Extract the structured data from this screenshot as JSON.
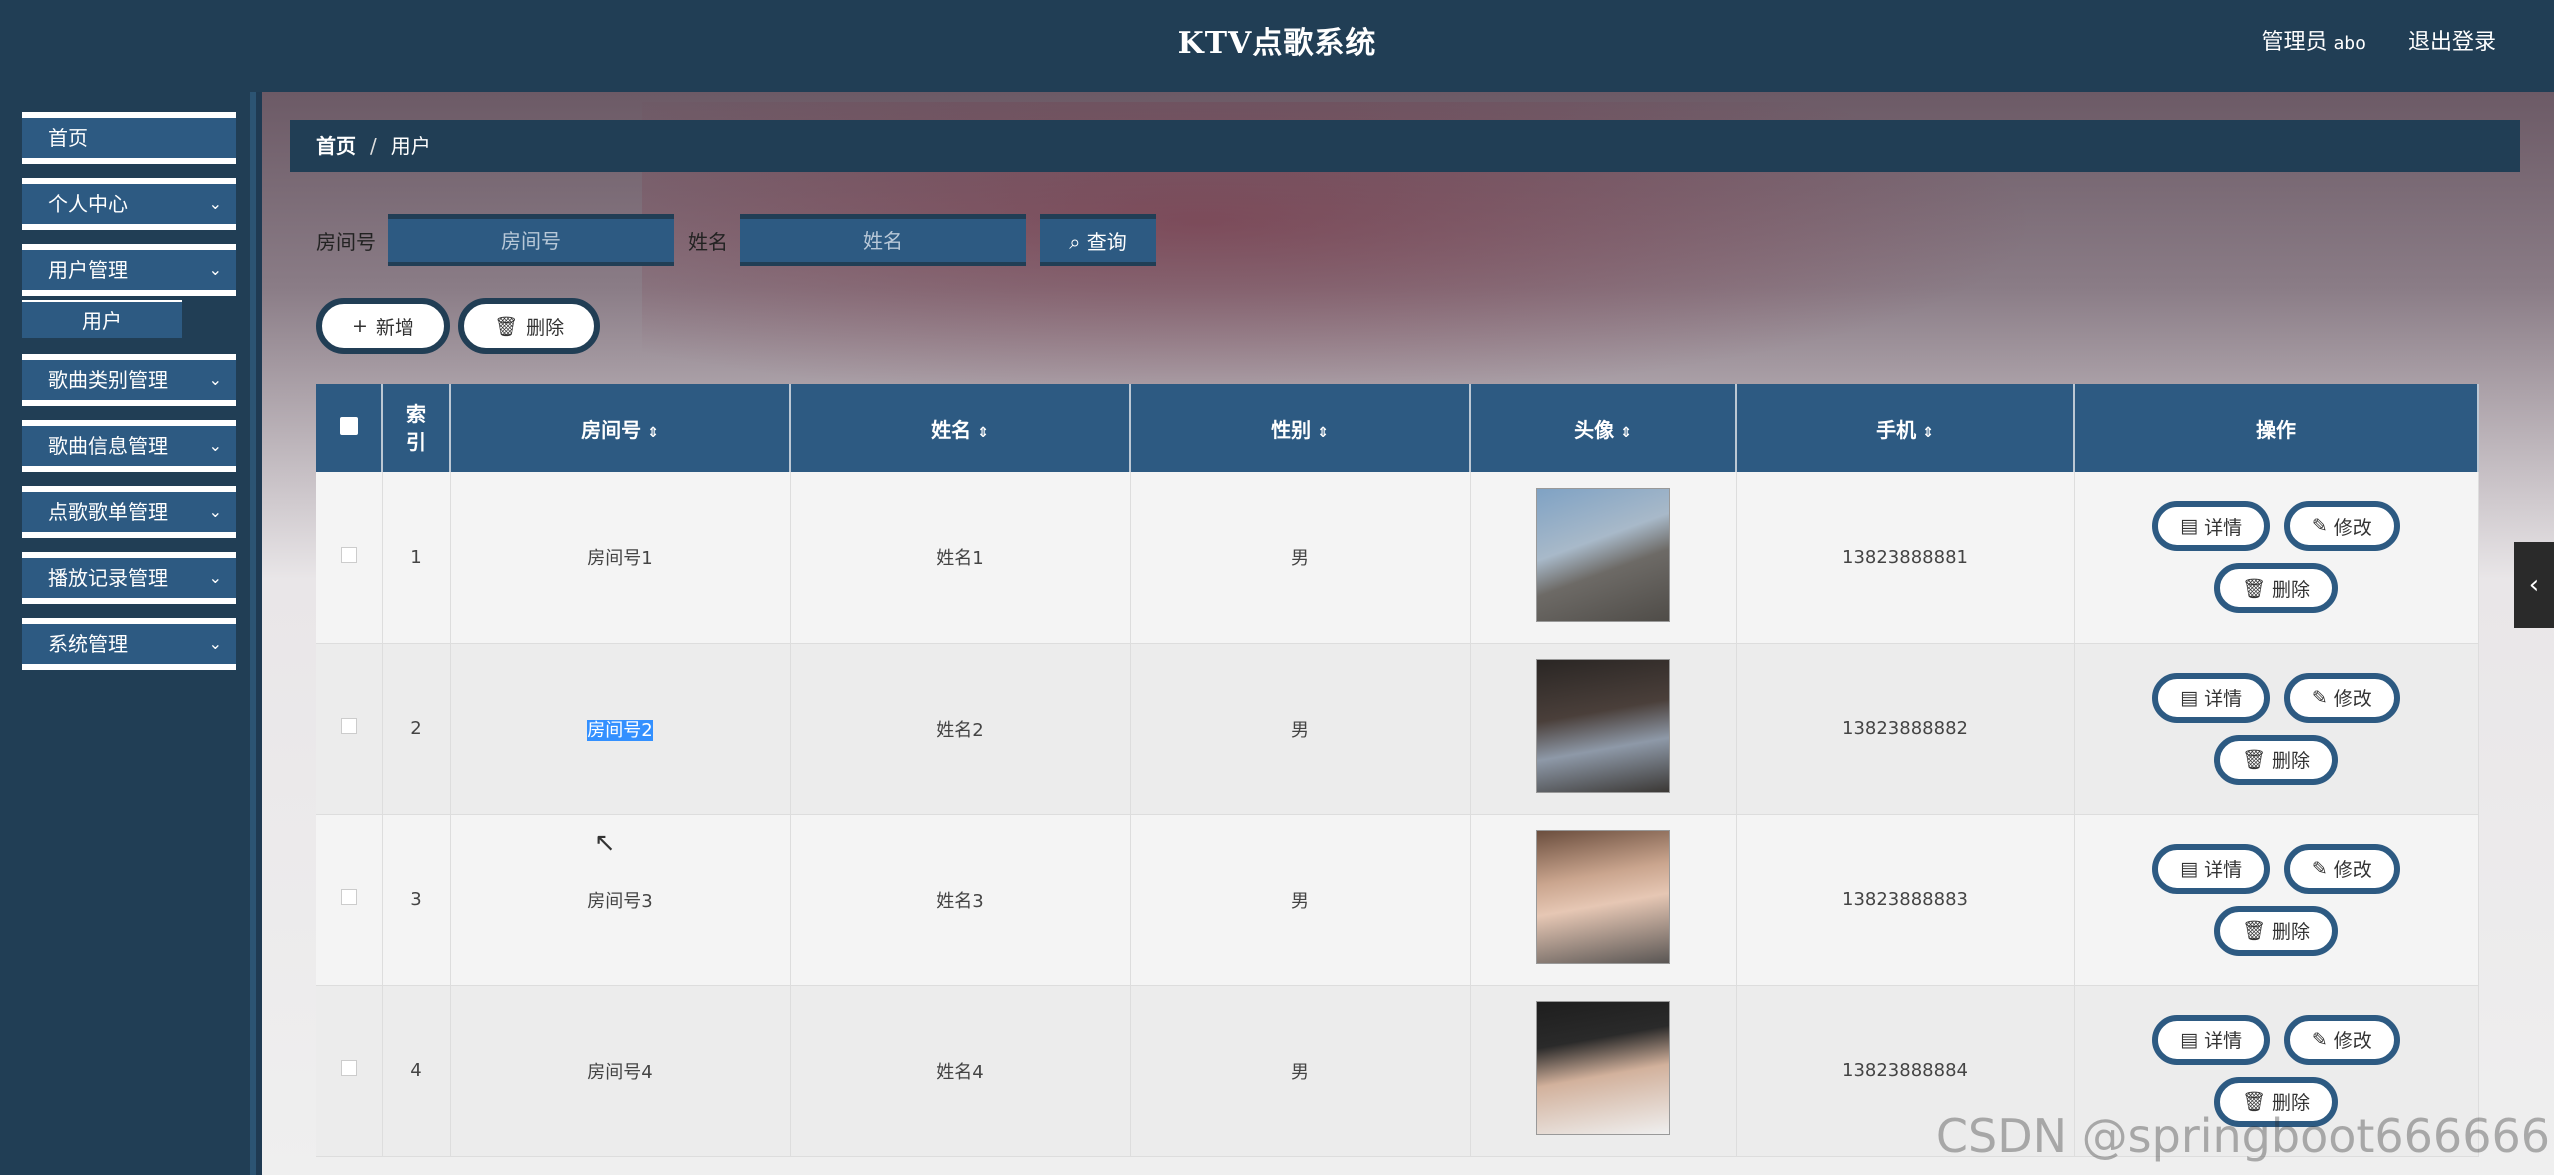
{
  "header": {
    "title": "KTV点歌系统",
    "admin_label": "管理员",
    "admin_name": "abo",
    "logout": "退出登录"
  },
  "sidebar": {
    "items": [
      {
        "label": "首页",
        "has_chevron": false
      },
      {
        "label": "个人中心",
        "has_chevron": true
      },
      {
        "label": "用户管理",
        "has_chevron": true
      },
      {
        "label": "歌曲类别管理",
        "has_chevron": true
      },
      {
        "label": "歌曲信息管理",
        "has_chevron": true
      },
      {
        "label": "点歌歌单管理",
        "has_chevron": true
      },
      {
        "label": "播放记录管理",
        "has_chevron": true
      },
      {
        "label": "系统管理",
        "has_chevron": true
      }
    ],
    "submenu_user": "用户"
  },
  "breadcrumb": {
    "home": "首页",
    "sep": "/",
    "current": "用户"
  },
  "search": {
    "room_label": "房间号",
    "room_placeholder": "房间号",
    "name_label": "姓名",
    "name_placeholder": "姓名",
    "query_button": "查询"
  },
  "actions": {
    "add": "新增",
    "delete": "删除"
  },
  "table": {
    "headers": [
      "索引",
      "房间号",
      "姓名",
      "性别",
      "头像",
      "手机",
      "操作"
    ],
    "rows": [
      {
        "index": "1",
        "room": "房间号1",
        "name": "姓名1",
        "gender": "男",
        "phone": "13823888881"
      },
      {
        "index": "2",
        "room": "房间号2",
        "name": "姓名2",
        "gender": "男",
        "phone": "13823888882"
      },
      {
        "index": "3",
        "room": "房间号3",
        "name": "姓名3",
        "gender": "男",
        "phone": "13823888883"
      },
      {
        "index": "4",
        "room": "房间号4",
        "name": "姓名4",
        "gender": "男",
        "phone": "13823888884"
      }
    ],
    "ops": {
      "detail": "详情",
      "edit": "修改",
      "delete": "删除"
    }
  },
  "watermark": "CSDN @springboot666666",
  "colors": {
    "dark": "#213e55",
    "accent": "#2d5a82",
    "selection": "#3390ff"
  }
}
